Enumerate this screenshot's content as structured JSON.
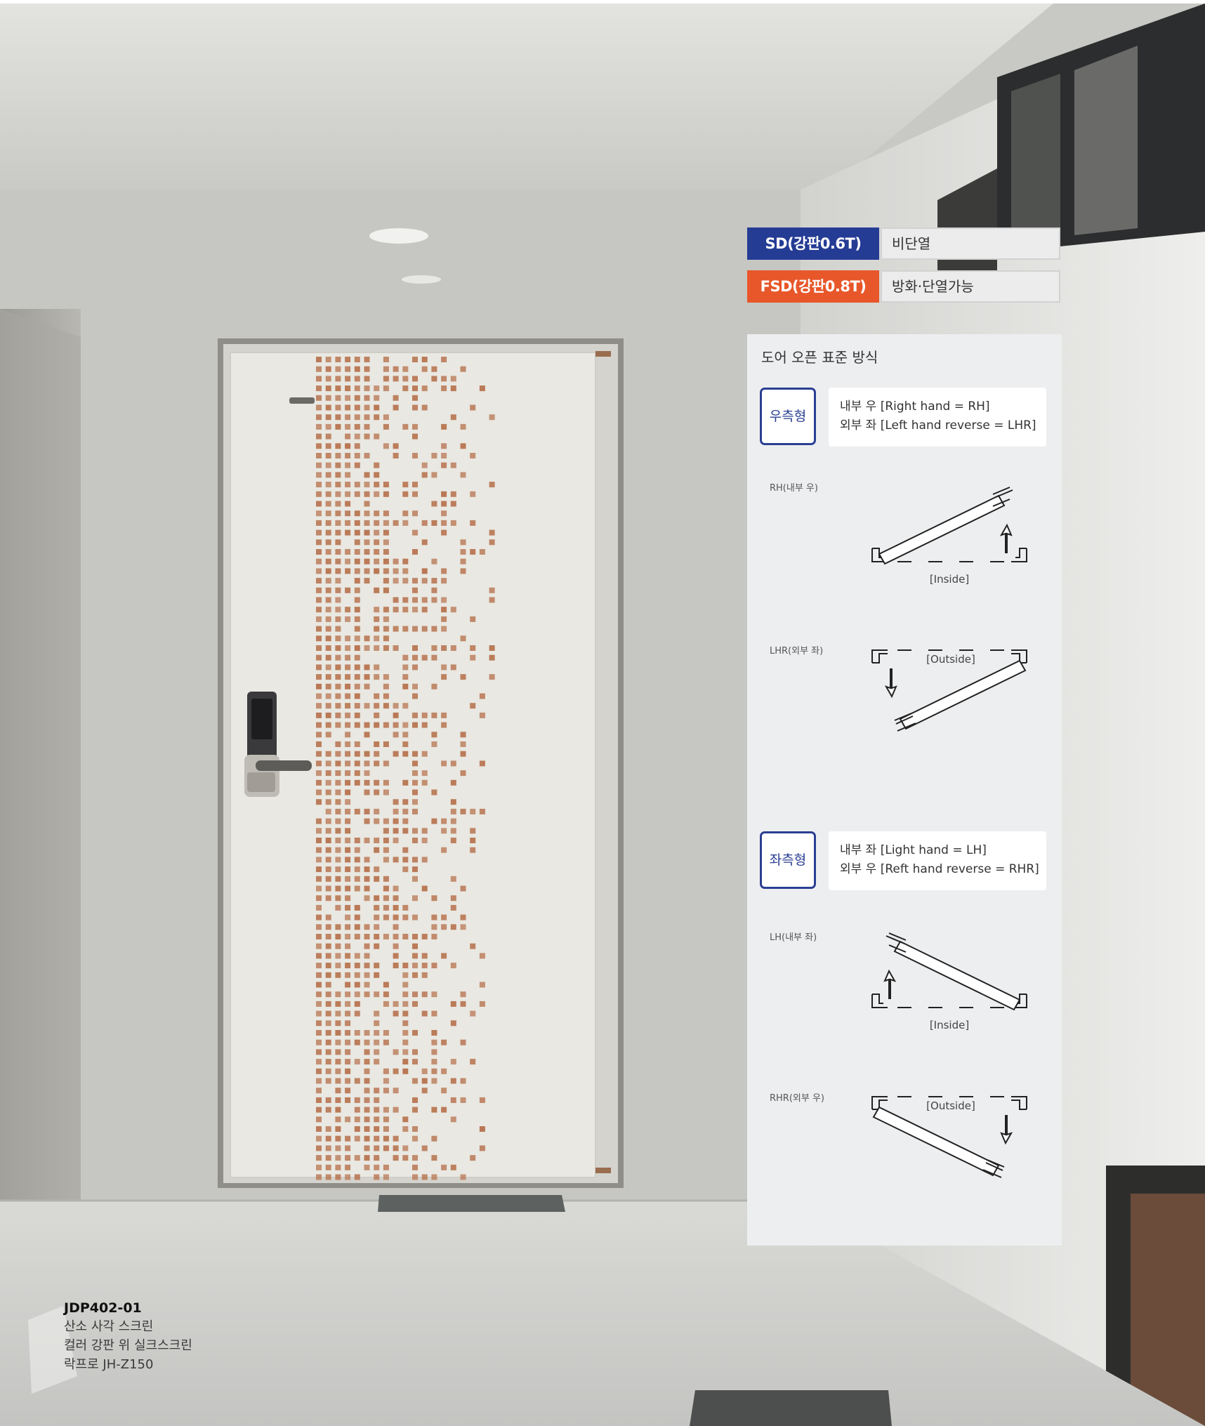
{
  "spec_tags": [
    {
      "code": "SD(강판0.6T)",
      "desc": "비단열",
      "color": "#253c95"
    },
    {
      "code": "FSD(강판0.8T)",
      "desc": "방화·단열가능",
      "color": "#e8572a"
    }
  ],
  "panel": {
    "title": "도어 오픈 표준 방식",
    "types": [
      {
        "badge": "우측형",
        "desc_line1": "내부 우 [Right hand = RH]",
        "desc_line2": "외부 좌 [Left hand reverse = LHR]",
        "diagrams": [
          {
            "label": "RH(내부 우)",
            "caption": "[Inside]"
          },
          {
            "label": "LHR(외부 좌)",
            "caption": "[Outside]"
          }
        ]
      },
      {
        "badge": "좌측형",
        "desc_line1": "내부 좌 [Light hand = LH]",
        "desc_line2": "외부 우 [Reft hand reverse = RHR]",
        "diagrams": [
          {
            "label": "LH(내부 좌)",
            "caption": "[Inside]"
          },
          {
            "label": "RHR(외부 우)",
            "caption": "[Outside]"
          }
        ]
      }
    ]
  },
  "caption": {
    "code": "JDP402-01",
    "line1": "산소 사각 스크린",
    "line2": "컬러 강판 위 실크스크린",
    "line3": "락프로 JH-Z150"
  },
  "colors": {
    "badge_border": "#2a3f92",
    "panel_bg": "#edeef0",
    "pattern": "#b97855",
    "door": "#e9e8e2"
  }
}
